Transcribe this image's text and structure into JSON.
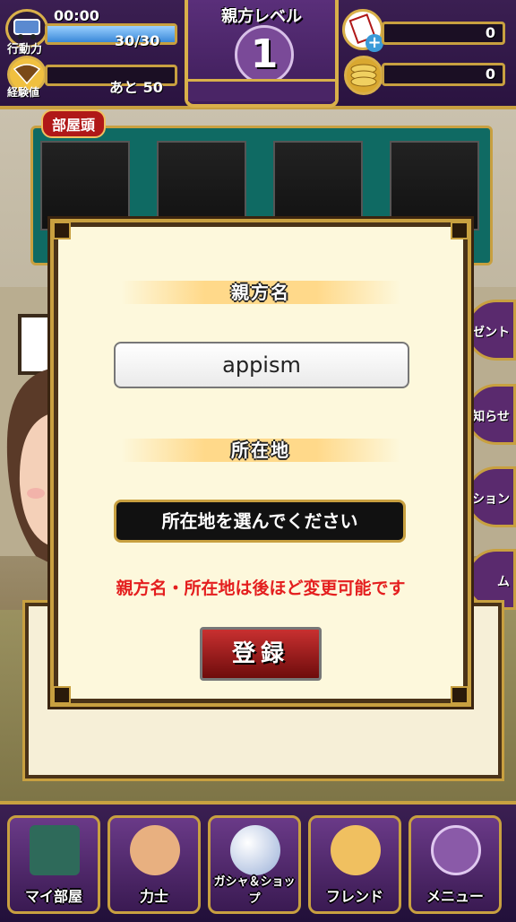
{
  "header": {
    "stamina_time": "00:00",
    "stamina_label": "行動力",
    "stamina_value": "30/30",
    "exp_label": "経験値",
    "exp_remaining": "あと 50",
    "level_title": "親方レベル",
    "level_value": "1",
    "tickets_value": "0",
    "coins_value": "0"
  },
  "heya": {
    "label": "部屋頭"
  },
  "side_buttons": [
    "ゼント",
    "知らせ",
    "ション",
    "ム"
  ],
  "dialog": {
    "name_heading": "親方名",
    "name_value": "appism",
    "location_heading": "所在地",
    "location_placeholder": "所在地を選んでください",
    "note": "親方名・所在地は後ほど変更可能です",
    "register_label": "登録"
  },
  "nav": {
    "my_room": "マイ部屋",
    "rikishi": "力士",
    "gacha_shop": "ガシャ＆ショップ",
    "friend": "フレンド",
    "menu": "メニュー"
  },
  "colors": {
    "accent_gold": "#c8a040",
    "purple": "#3b1f52",
    "note_red": "#e41e1e",
    "register_red": "#b01818"
  }
}
